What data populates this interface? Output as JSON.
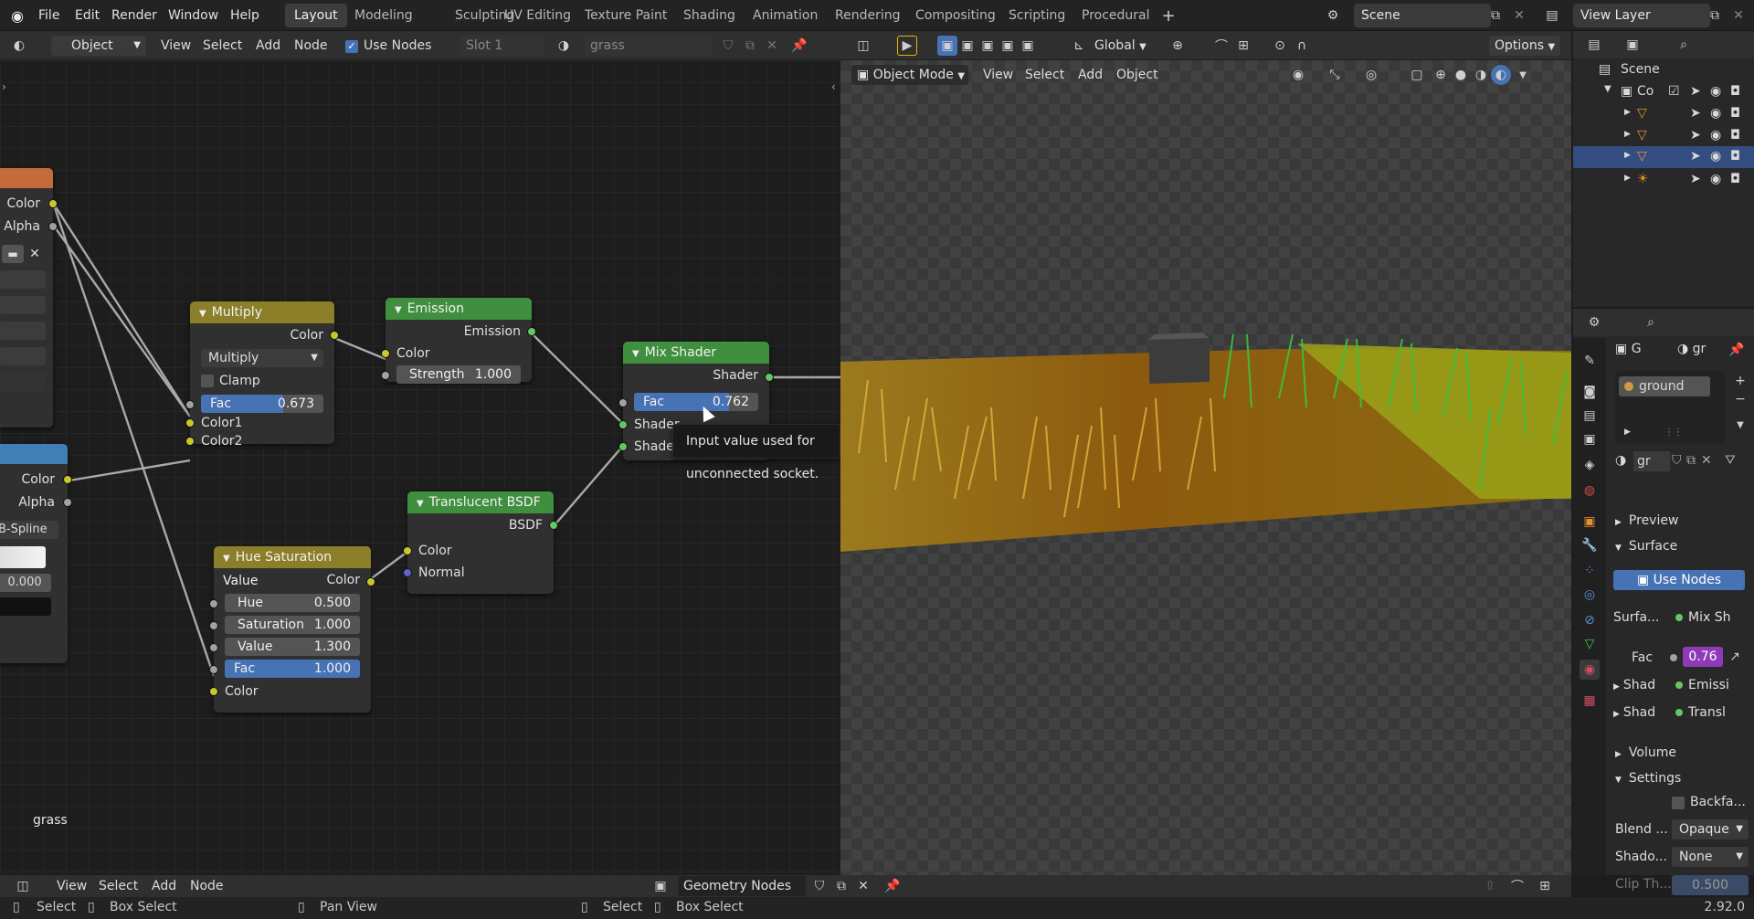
{
  "menu": {
    "items": [
      "File",
      "Edit",
      "Render",
      "Window",
      "Help"
    ],
    "workspace_tabs": [
      "Layout",
      "Modeling",
      "Sculpting",
      "UV Editing",
      "Texture Paint",
      "Shading",
      "Animation",
      "Rendering",
      "Compositing",
      "Scripting",
      "Procedural"
    ],
    "scene": "Scene",
    "view_layer": "View Layer"
  },
  "node_header": {
    "object_dropdown": "Object",
    "view": "View",
    "select": "Select",
    "add": "Add",
    "node": "Node",
    "use_nodes": "Use Nodes",
    "slot": "Slot 1",
    "material": "grass"
  },
  "viewport_header": {
    "transform": "Global",
    "options": "Options",
    "mode": "Object Mode",
    "view": "View",
    "select": "Select",
    "add": "Add",
    "object": "Object"
  },
  "nodes": {
    "left_image": {
      "color": "Color",
      "alpha": "Alpha"
    },
    "left_ramp": {
      "color": "Color",
      "alpha": "Alpha",
      "interp": "B-Spline",
      "pos": "0.000"
    },
    "multiply": {
      "title": "Multiply",
      "out_color": "Color",
      "mode": "Multiply",
      "clamp": "Clamp",
      "fac_label": "Fac",
      "fac_value": "0.673",
      "fac_fill": 0.673,
      "color1": "Color1",
      "color2": "Color2"
    },
    "emission": {
      "title": "Emission",
      "out": "Emission",
      "color": "Color",
      "strength_label": "Strength",
      "strength_value": "1.000"
    },
    "mix_shader": {
      "title": "Mix Shader",
      "out": "Shader",
      "fac_label": "Fac",
      "fac_value": "0.762",
      "fac_fill": 0.762,
      "shader1": "Shader",
      "shader2": "Shader"
    },
    "translucent": {
      "title": "Translucent BSDF",
      "out": "BSDF",
      "color": "Color",
      "normal": "Normal"
    },
    "hsv": {
      "title": "Hue Saturation Value",
      "out": "Color",
      "hue_label": "Hue",
      "hue": "0.500",
      "sat_label": "Saturation",
      "sat": "1.000",
      "val_label": "Value",
      "val": "1.300",
      "fac_label": "Fac",
      "fac": "1.000",
      "color_in": "Color"
    }
  },
  "tooltip": "Input value used for unconnected socket.",
  "material_label": "grass",
  "bottom_header": {
    "view": "View",
    "select": "Select",
    "add": "Add",
    "node": "Node",
    "tree_name": "Geometry Nodes"
  },
  "outliner": {
    "root": "Scene",
    "collection": "Co"
  },
  "properties": {
    "object_short": "G",
    "material_short": "gr",
    "material_slot": "ground",
    "mat_name": "gr",
    "preview": "Preview",
    "surface": "Surface",
    "use_nodes": "Use Nodes",
    "surface_label": "Surfa...",
    "surface_value": "Mix Sh",
    "fac_label": "Fac",
    "fac_value": "0.76",
    "shad1_label": "Shad",
    "shad1_value": "Emissi",
    "shad2_label": "Shad",
    "shad2_value": "Transl",
    "volume": "Volume",
    "settings": "Settings",
    "backface": "Backfa...",
    "blend_label": "Blend ...",
    "blend_value": "Opaque",
    "shadow_label": "Shado...",
    "shadow_value": "None",
    "clip_label": "Clip Th...",
    "clip_value": "0.500"
  },
  "status": {
    "select": "Select",
    "box_select": "Box Select",
    "pan_view": "Pan View",
    "select2": "Select",
    "box_select2": "Box Select",
    "version": "2.92.0"
  },
  "colors": {
    "accent_blue": "#4772b3",
    "shader_green": "#3f8f3f",
    "converter_yellow": "#8b7f29"
  }
}
